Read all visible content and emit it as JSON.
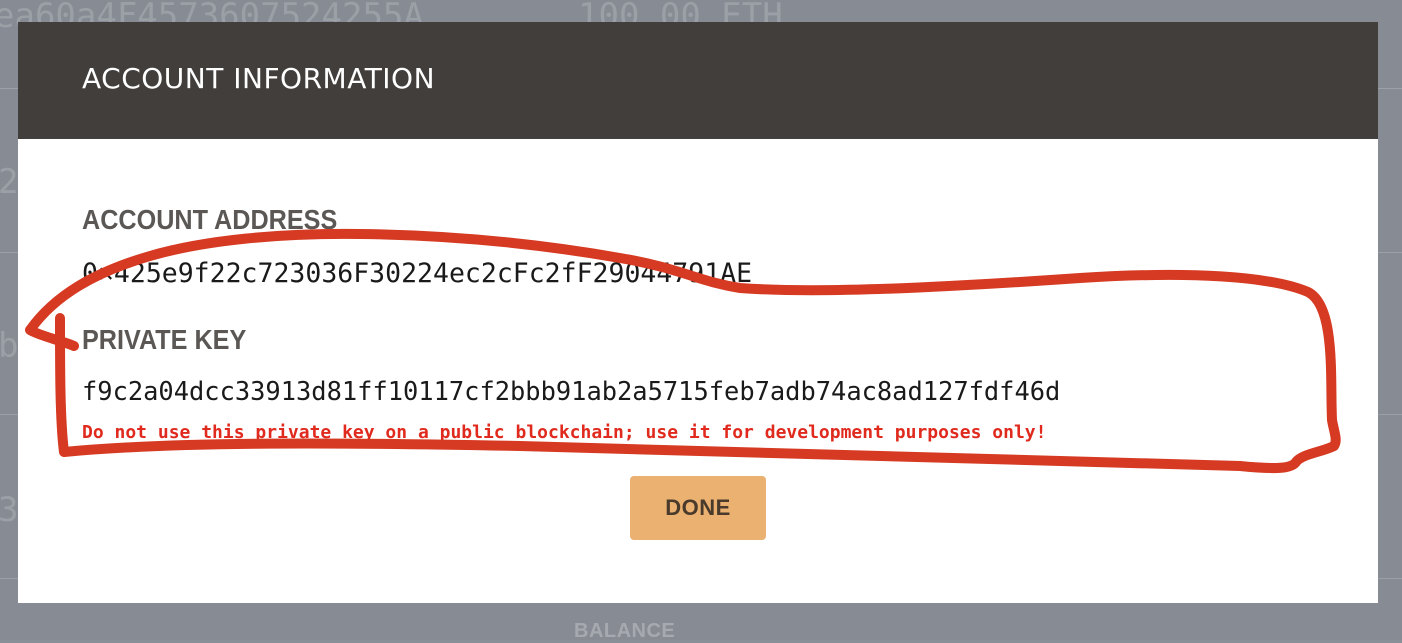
{
  "background": {
    "top_address_fragment": "ea60a4F4573607524255A",
    "top_balance_fragment": "100.00 ETH",
    "left_fragments": [
      "2",
      "b",
      "3"
    ],
    "balance_header": "BALANCE"
  },
  "modal": {
    "title": "ACCOUNT INFORMATION",
    "address_label": "ACCOUNT ADDRESS",
    "address_value": "0×425e9f22c723036F30224ec2cFc2fF29044791AE",
    "private_key_label": "PRIVATE KEY",
    "private_key_value": "f9c2a04dcc33913d81ff10117cf2bbb91ab2a5715feb7adb74ac8ad127fdf46d",
    "warning": "Do not use this private key on a public blockchain; use it for development purposes only!",
    "done_label": "DONE"
  },
  "colors": {
    "header_bg": "#423e3b",
    "accent_button": "#eab170",
    "warning_text": "#e02a1e",
    "annotation_stroke": "#d63a22"
  }
}
